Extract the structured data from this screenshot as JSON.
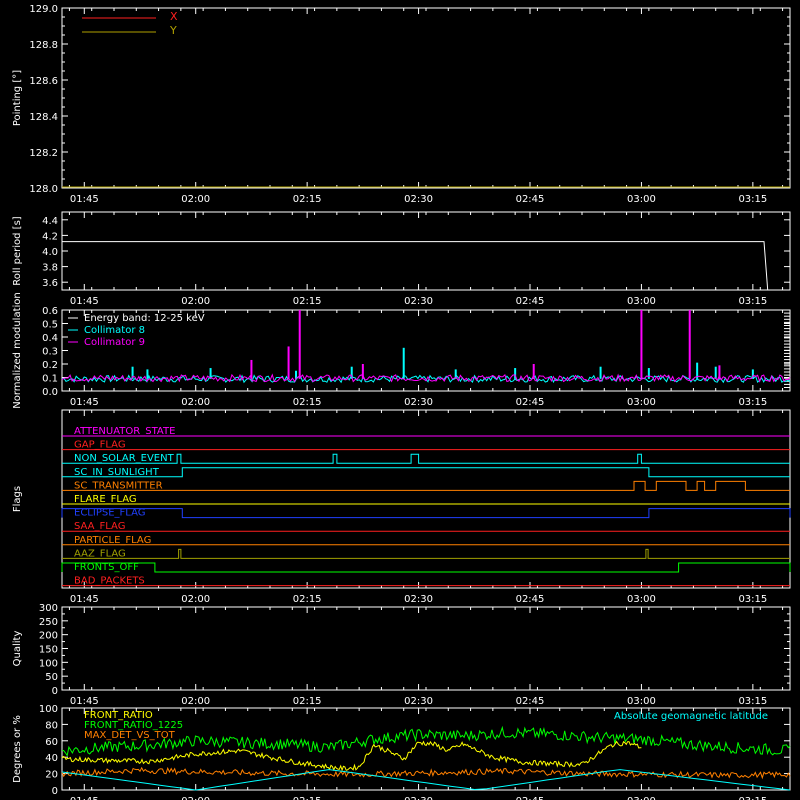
{
  "time_axis": {
    "ticks": [
      "01:45",
      "02:00",
      "02:15",
      "02:30",
      "02:45",
      "03:00",
      "03:15"
    ],
    "range_minutes": [
      102,
      200
    ]
  },
  "chart_data": [
    {
      "id": "pointing",
      "type": "line",
      "ylabel": "Pointing [°]",
      "ylim": [
        128.0,
        129.0
      ],
      "yticks": [
        "128.0",
        "128.2",
        "128.4",
        "128.6",
        "128.8",
        "129.0"
      ],
      "legend_placement": "top-left",
      "series": [
        {
          "name": "X",
          "color": "#ff2020",
          "values": []
        },
        {
          "name": "Y",
          "color": "#b0a000",
          "values": []
        }
      ]
    },
    {
      "id": "roll-period",
      "type": "line",
      "ylabel": "Roll period [s]",
      "ylim": [
        3.5,
        4.5
      ],
      "yticks": [
        "3.6",
        "3.8",
        "4.0",
        "4.2",
        "4.4"
      ],
      "series": [
        {
          "color": "#ffffff",
          "x_minutes": [
            102,
            196.5,
            197.0
          ],
          "values": [
            4.12,
            4.12,
            3.5
          ]
        }
      ]
    },
    {
      "id": "modulation",
      "type": "line",
      "ylabel": "Normalized modulation",
      "ylim": [
        0,
        0.6
      ],
      "yticks": [
        "0.0",
        "0.1",
        "0.2",
        "0.3",
        "0.4",
        "0.5",
        "0.6"
      ],
      "legend_placement": "top-left",
      "legend_text": "Energy band: 12-25 keV",
      "baseline": 0.09,
      "series": [
        {
          "name": "Collimator 8",
          "color": "#00ffff",
          "spikes": [
            [
              111.5,
              0.18
            ],
            [
              113.5,
              0.16
            ],
            [
              122,
              0.17
            ],
            [
              133.5,
              0.15
            ],
            [
              141,
              0.18
            ],
            [
              148,
              0.32
            ],
            [
              155,
              0.16
            ],
            [
              163,
              0.17
            ],
            [
              174.5,
              0.18
            ],
            [
              181,
              0.17
            ],
            [
              187.5,
              0.21
            ],
            [
              190,
              0.18
            ],
            [
              195,
              0.16
            ]
          ]
        },
        {
          "name": "Collimator 9",
          "color": "#ff00ff",
          "spikes": [
            [
              127.5,
              0.23
            ],
            [
              132.5,
              0.33
            ],
            [
              134,
              0.6
            ],
            [
              142.5,
              0.2
            ],
            [
              165.5,
              0.2
            ],
            [
              180,
              0.6
            ],
            [
              186.5,
              0.6
            ],
            [
              190.5,
              0.19
            ]
          ]
        }
      ]
    },
    {
      "id": "flags",
      "type": "line",
      "ylabel": "Flags",
      "flags": [
        {
          "name": "ATTENUATOR_STATE",
          "color": "#ff00ff",
          "high": []
        },
        {
          "name": "GAP_FLAG",
          "color": "#ff2020",
          "high": []
        },
        {
          "name": "NON_SOLAR_EVENT",
          "color": "#00ffff",
          "high": [
            [
              117.5,
              118
            ],
            [
              138.5,
              139
            ],
            [
              149,
              150
            ],
            [
              179.5,
              180
            ]
          ]
        },
        {
          "name": "SC_IN_SUNLIGHT",
          "color": "#00ffff",
          "high": [
            [
              118.2,
              181
            ]
          ]
        },
        {
          "name": "SC_TRANSMITTER",
          "color": "#ff8000",
          "high": [
            [
              179,
              180.5
            ],
            [
              182,
              186
            ],
            [
              187.5,
              188.5
            ],
            [
              190,
              194
            ]
          ]
        },
        {
          "name": "FLARE_FLAG",
          "color": "#ffff00",
          "high": []
        },
        {
          "name": "ECLIPSE_FLAG",
          "color": "#2040ff",
          "high": [
            [
              102,
              118.2
            ],
            [
              181,
              200
            ]
          ]
        },
        {
          "name": "SAA_FLAG",
          "color": "#ff2020",
          "high": []
        },
        {
          "name": "PARTICLE_FLAG",
          "color": "#ff8000",
          "high": []
        },
        {
          "name": "AAZ_FLAG",
          "color": "#a0a000",
          "high": [
            [
              117.7,
              118
            ],
            [
              180.6,
              180.9
            ]
          ]
        },
        {
          "name": "FRONTS_OFF",
          "color": "#00ff00",
          "high": [
            [
              102,
              114.5
            ],
            [
              185,
              200
            ]
          ]
        },
        {
          "name": "BAD_PACKETS",
          "color": "#ff2020",
          "high": []
        }
      ]
    },
    {
      "id": "quality",
      "type": "line",
      "ylabel": "Quality",
      "ylim": [
        0,
        300
      ],
      "yticks": [
        "0",
        "50",
        "100",
        "150",
        "200",
        "250",
        "300"
      ],
      "series": []
    },
    {
      "id": "ratios",
      "type": "line",
      "ylabel": "Degrees or %",
      "ylim": [
        0,
        100
      ],
      "yticks": [
        "0",
        "20",
        "40",
        "60",
        "80",
        "100"
      ],
      "legend_placement": "top-left",
      "annotation": "Absolute geomagnetic latitude",
      "series": [
        {
          "name": "FRONT_RATIO",
          "color": "#ffff00",
          "x_minutes": [
            102,
            108,
            114,
            120,
            126,
            130,
            134,
            138,
            140,
            142,
            144,
            146,
            148,
            150,
            152,
            154,
            156,
            160,
            164,
            168,
            172,
            176,
            178,
            180
          ],
          "values": [
            38,
            36,
            35,
            44,
            48,
            40,
            33,
            28,
            26,
            28,
            55,
            47,
            38,
            58,
            56,
            48,
            56,
            40,
            34,
            32,
            31,
            55,
            58,
            52
          ]
        },
        {
          "name": "FRONT_RATIO_1225",
          "color": "#00ff00",
          "x_minutes": [
            102,
            108,
            114,
            120,
            126,
            132,
            138,
            144,
            150,
            156,
            162,
            168,
            174,
            180,
            186,
            192,
            200
          ],
          "values": [
            48,
            52,
            55,
            60,
            58,
            56,
            52,
            62,
            68,
            66,
            70,
            68,
            64,
            62,
            56,
            52,
            48
          ]
        },
        {
          "name": "MAX_DET_VS_TOT",
          "color": "#ff8000",
          "x_minutes": [
            102,
            112,
            122,
            132,
            142,
            152,
            162,
            172,
            182,
            192,
            200
          ],
          "values": [
            20,
            24,
            22,
            20,
            19,
            21,
            23,
            20,
            19,
            18,
            19
          ]
        },
        {
          "name": "Absolute geomagnetic latitude",
          "color": "#00ffff",
          "x_minutes": [
            102,
            120,
            138,
            158,
            177,
            200
          ],
          "values": [
            22,
            0,
            25,
            0,
            25,
            0
          ]
        }
      ]
    }
  ]
}
